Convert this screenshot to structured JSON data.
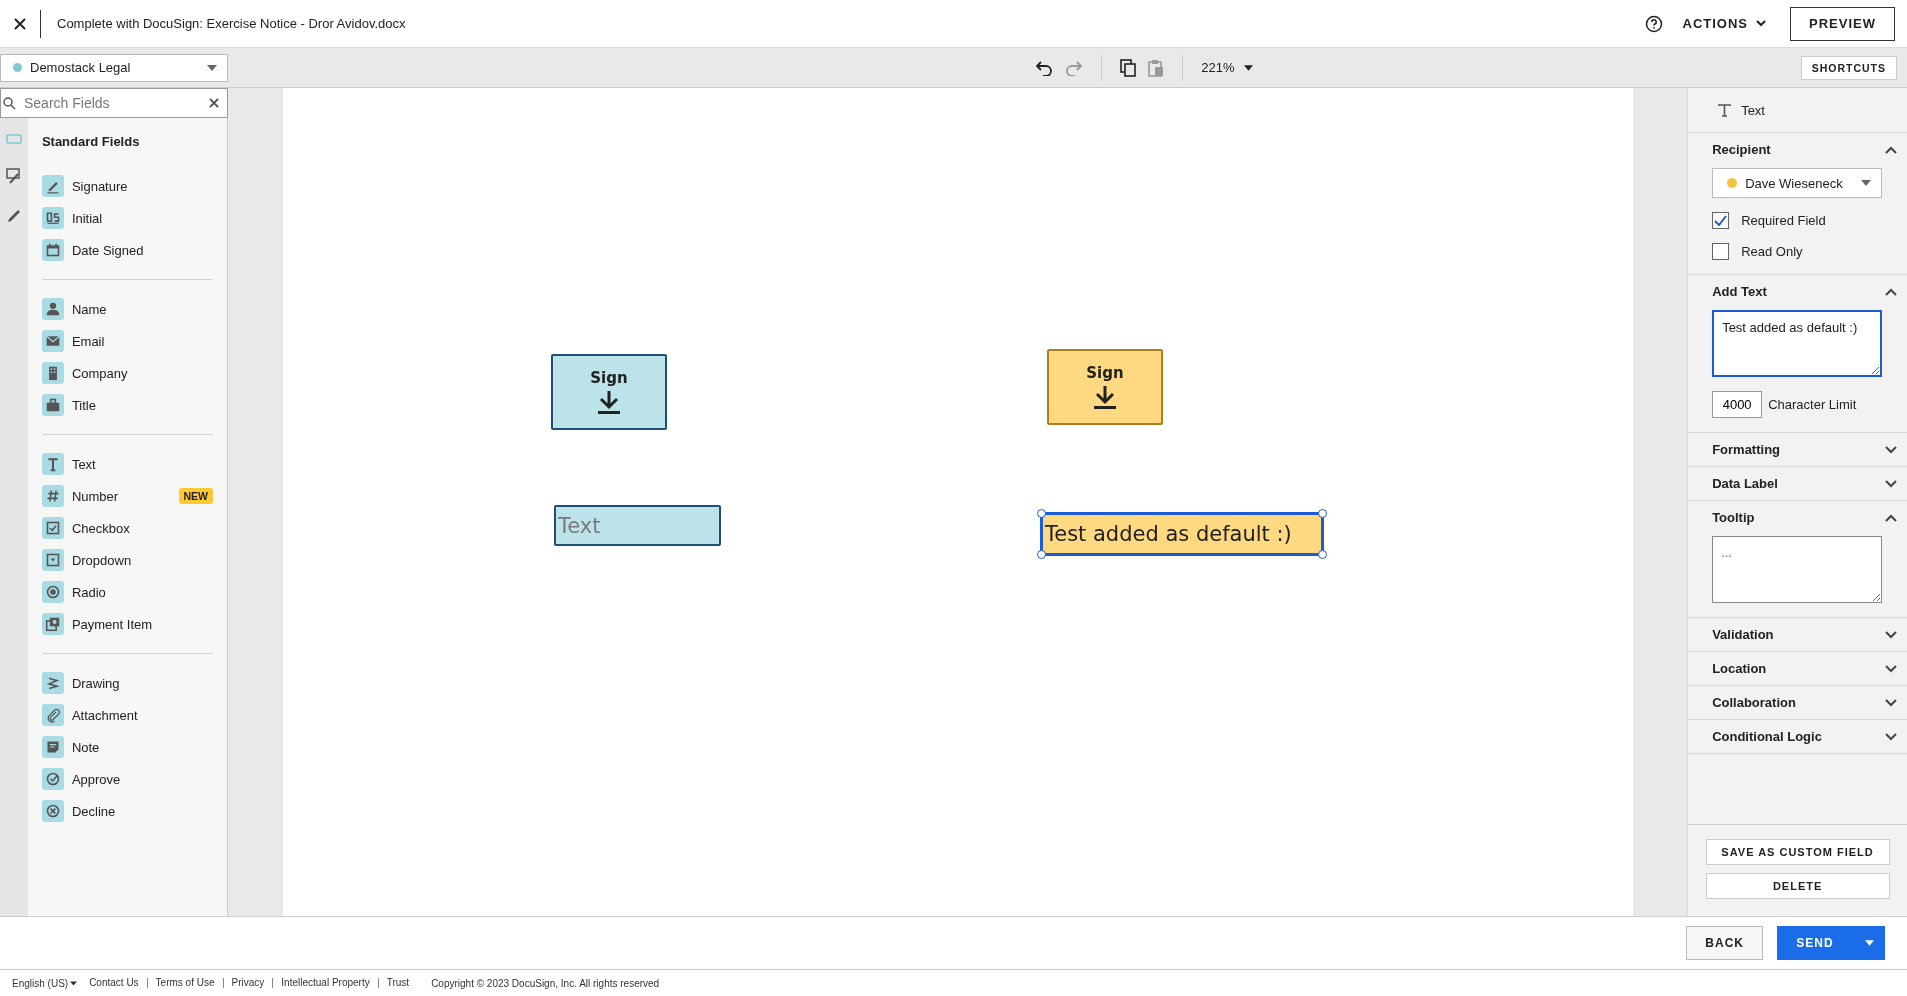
{
  "top_bar": {
    "title": "Complete with DocuSign: Exercise Notice - Dror Avidov.docx",
    "actions": "ACTIONS",
    "preview": "PREVIEW"
  },
  "toolbar": {
    "account": "Demostack Legal",
    "zoom": "221%",
    "shortcuts": "SHORTCUTS"
  },
  "sidebar": {
    "search": {
      "placeholder": "Search Fields"
    },
    "heading": "Standard Fields",
    "groups": [
      [
        {
          "label": "Signature"
        },
        {
          "label": "Initial"
        },
        {
          "label": "Date Signed"
        }
      ],
      [
        {
          "label": "Name"
        },
        {
          "label": "Email"
        },
        {
          "label": "Company"
        },
        {
          "label": "Title"
        }
      ],
      [
        {
          "label": "Text"
        },
        {
          "label": "Number",
          "badge": "NEW"
        },
        {
          "label": "Checkbox"
        },
        {
          "label": "Dropdown"
        },
        {
          "label": "Radio"
        },
        {
          "label": "Payment Item"
        }
      ],
      [
        {
          "label": "Drawing"
        },
        {
          "label": "Attachment"
        },
        {
          "label": "Note"
        },
        {
          "label": "Approve"
        },
        {
          "label": "Decline"
        }
      ]
    ]
  },
  "canvas": {
    "fields": [
      {
        "kind": "sign",
        "label": "Sign",
        "color": "#bce3ea",
        "selected": false
      },
      {
        "kind": "sign",
        "label": "Sign",
        "color": "#ffd882",
        "selected": false
      },
      {
        "kind": "text",
        "placeholder": "Text",
        "color": "#bce3ea",
        "selected": false
      },
      {
        "kind": "text",
        "value": "Test added as default :)",
        "color": "#ffd882",
        "selected": true
      }
    ]
  },
  "properties": {
    "field_type": "Text",
    "sections": [
      {
        "kind": "recipient",
        "title": "Recipient",
        "expanded": true,
        "recipient": {
          "name": "Dave Wieseneck",
          "color": "#f5c342"
        },
        "options": [
          {
            "label": "Required Field",
            "checked": true
          },
          {
            "label": "Read Only",
            "checked": false
          }
        ]
      },
      {
        "kind": "add_text",
        "title": "Add Text",
        "expanded": true,
        "value": "Test added as default :)",
        "limit": "4000",
        "limit_label": "Character Limit"
      },
      {
        "kind": "plain",
        "title": "Formatting",
        "expanded": false
      },
      {
        "kind": "plain",
        "title": "Data Label",
        "expanded": false
      },
      {
        "kind": "tooltip",
        "title": "Tooltip",
        "expanded": true,
        "placeholder": "..."
      },
      {
        "kind": "plain",
        "title": "Validation",
        "expanded": false
      },
      {
        "kind": "plain",
        "title": "Location",
        "expanded": false
      },
      {
        "kind": "plain",
        "title": "Collaboration",
        "expanded": false
      },
      {
        "kind": "plain",
        "title": "Conditional Logic",
        "expanded": false
      }
    ],
    "buttons": [
      "SAVE AS CUSTOM FIELD",
      "DELETE"
    ]
  },
  "bottom_bar": {
    "back": "BACK",
    "send": "SEND"
  },
  "footer": {
    "language": "English (US)",
    "links": [
      "Contact Us",
      "Terms of Use",
      "Privacy",
      "Intellectual Property",
      "Trust"
    ],
    "copyright": "Copyright © 2023 DocuSign, Inc. All rights reserved"
  }
}
